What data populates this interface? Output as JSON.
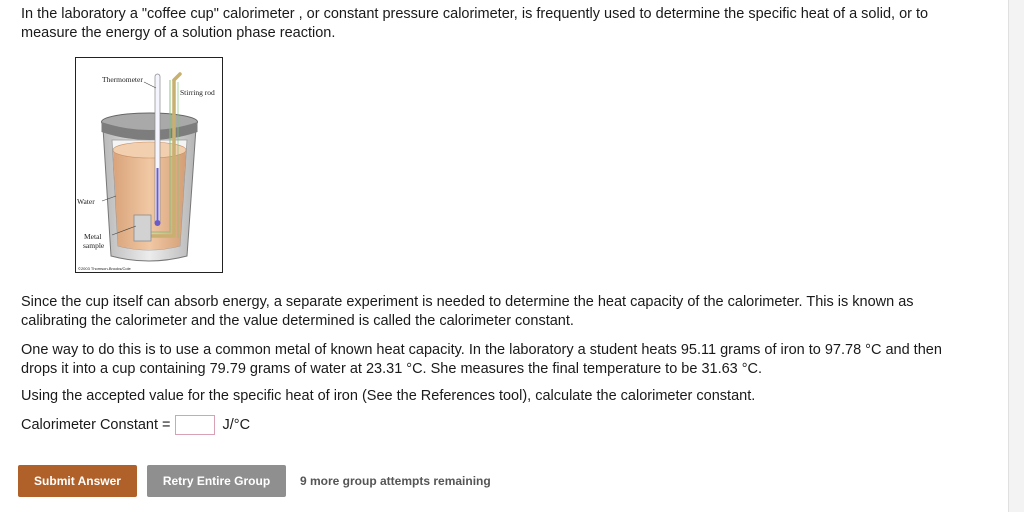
{
  "intro_text": "In the laboratory a \"coffee cup\" calorimeter , or constant pressure calorimeter, is frequently used to determine the specific heat of a solid, or to measure the energy of a solution phase reaction.",
  "figure": {
    "labels": {
      "thermometer": "Thermometer",
      "stirring_rod": "Stirring rod",
      "water": "Water",
      "metal_line1": "Metal",
      "metal_line2": "sample",
      "copyright": "©2003 Thomson-Brooks/Cole"
    },
    "colors": {
      "water": "#e6b790",
      "lid": "#8a8a8a",
      "cup": "#cfcfcf",
      "rod": "#c8b070"
    }
  },
  "para_calibration": "Since the cup itself can absorb energy, a separate experiment is needed to determine the heat capacity of the calorimeter. This is known as calibrating the calorimeter and the value determined is called the calorimeter constant.",
  "para_experiment": "One way to do this is to use a common metal of known heat capacity. In the laboratory a student heats 95.11 grams of iron to 97.78 °C and then drops it into a cup containing 79.79 grams of water at 23.31 °C. She measures the final temperature to be 31.63 °C.",
  "para_instruction": "Using the accepted value for the specific heat of iron (See the References tool), calculate the calorimeter constant.",
  "answer": {
    "label": "Calorimeter Constant =",
    "value": "",
    "unit": "J/°C"
  },
  "buttons": {
    "submit": "Submit Answer",
    "retry": "Retry Entire Group",
    "remaining": "9 more group attempts remaining"
  },
  "colors": {
    "submit_bg": "#b0612a",
    "retry_bg": "#8f8f8f",
    "input_border": "#d9a0b6"
  }
}
